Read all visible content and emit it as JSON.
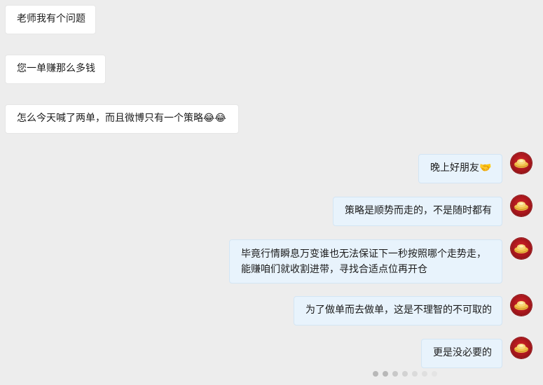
{
  "messages": [
    {
      "side": "in",
      "text": "老师我有个问题",
      "emoji": ""
    },
    {
      "side": "in",
      "text": "您一单赚那么多钱",
      "emoji": ""
    },
    {
      "side": "in",
      "text": "怎么今天喊了两单，而且微博只有一个策略",
      "emoji": "😂😂"
    },
    {
      "side": "out",
      "text": "晚上好朋友",
      "emoji": "🤝"
    },
    {
      "side": "out",
      "text": "策略是顺势而走的，不是随时都有",
      "emoji": ""
    },
    {
      "side": "out",
      "line1": "毕竟行情瞬息万变谁也无法保证下一秒按照哪个走势走，",
      "line2": "能赚咱们就收割进带，寻找合适点位再开仓"
    },
    {
      "side": "out",
      "text": "为了做单而去做单，这是不理智的不可取的",
      "emoji": ""
    },
    {
      "side": "out",
      "text": "更是没必要的",
      "emoji": ""
    }
  ],
  "avatar_icon": "gold-ingot-avatar-icon",
  "colors": {
    "background": "#ededed",
    "incoming_bubble": "#ffffff",
    "outgoing_bubble": "#e8f3fc",
    "avatar": "#c41c22"
  }
}
